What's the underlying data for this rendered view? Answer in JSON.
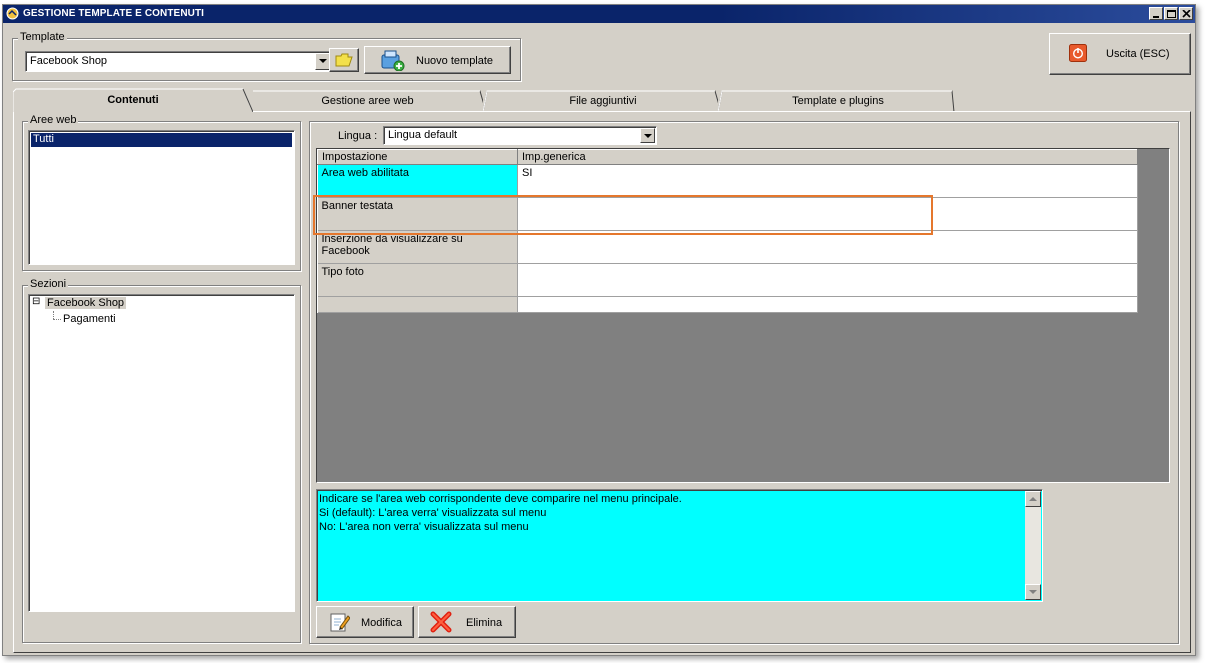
{
  "window": {
    "title": "GESTIONE TEMPLATE E CONTENUTI",
    "controls": [
      "minimize-icon",
      "maximize-icon",
      "close-icon"
    ]
  },
  "template_group": {
    "label": "Template",
    "selected": "Facebook Shop",
    "new_button_label": "Nuovo template"
  },
  "exit_button": {
    "label": "Uscita (ESC)"
  },
  "tabs": [
    {
      "label": "Contenuti",
      "active": true
    },
    {
      "label": "Gestione aree web",
      "active": false
    },
    {
      "label": "File aggiuntivi",
      "active": false
    },
    {
      "label": "Template e plugins",
      "active": false
    }
  ],
  "aree_web": {
    "label": "Aree web",
    "items": [
      {
        "label": "Tutti",
        "selected": true
      }
    ]
  },
  "sezioni": {
    "label": "Sezioni",
    "expander": "⊟",
    "root": "Facebook Shop",
    "children": [
      "Pagamenti"
    ]
  },
  "lingua": {
    "label": "Lingua :",
    "selected": "Lingua default"
  },
  "grid": {
    "columns": [
      "Impostazione",
      "Imp.generica"
    ],
    "rows": [
      {
        "name": "Area web abilitata",
        "value": "SI",
        "selected": true
      },
      {
        "name": "Banner testata",
        "value": ""
      },
      {
        "name": "Inserzione da visualizzare su Facebook",
        "value": ""
      },
      {
        "name": "Tipo foto",
        "value": ""
      }
    ]
  },
  "description": {
    "lines": [
      "Indicare se l'area web corrispondente deve comparire nel menu principale.",
      "Si (default): L'area verra' visualizzata sul menu",
      "No: L'area non verra' visualizzata sul menu"
    ]
  },
  "actions": {
    "edit_label": "Modifica",
    "delete_label": "Elimina"
  },
  "colors": {
    "titlebar": "#0a246a",
    "face": "#d4d0c8",
    "selection": "#0a246a",
    "cell_highlight": "#00ffff",
    "annotation_box": "#e5772d"
  }
}
